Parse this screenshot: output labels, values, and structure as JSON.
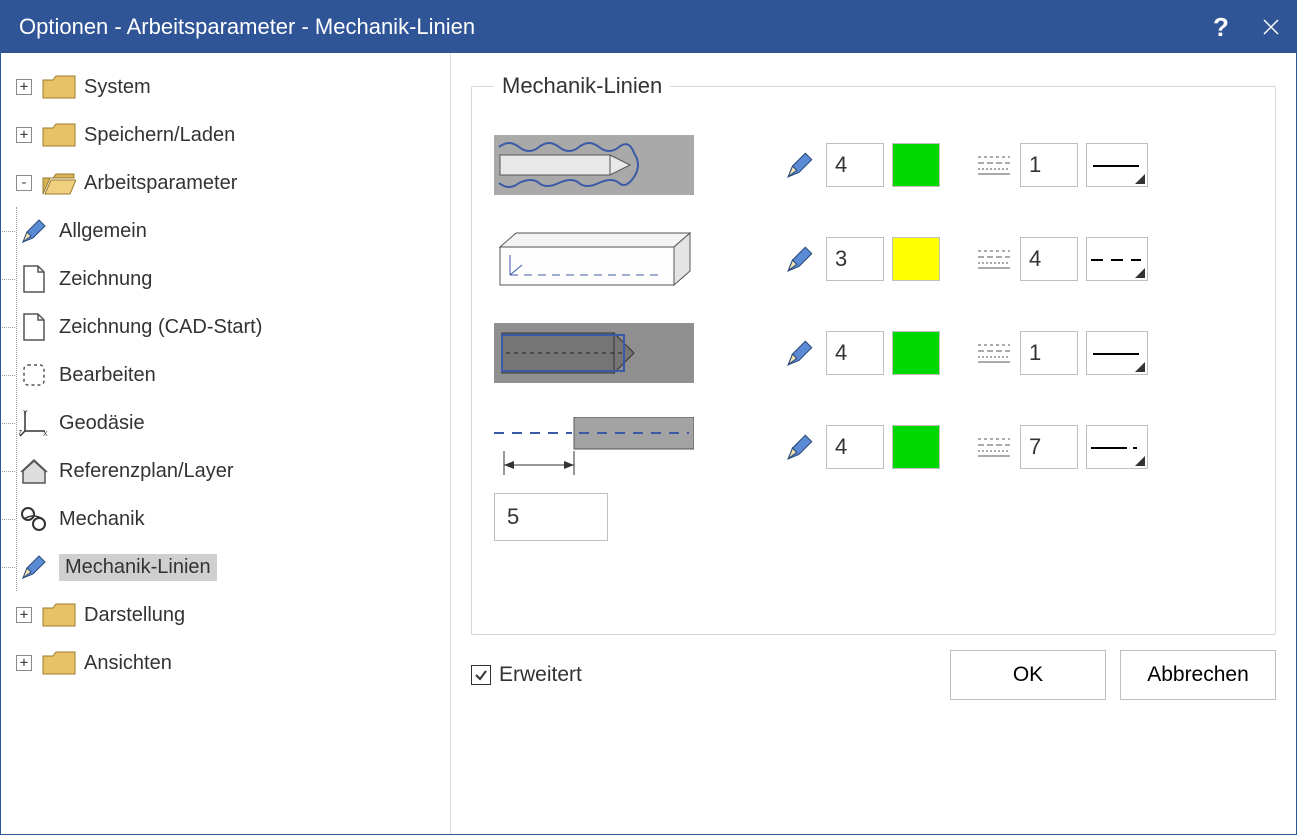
{
  "title": "Optionen - Arbeitsparameter - Mechanik-Linien",
  "tree": {
    "system": "System",
    "save": "Speichern/Laden",
    "work": "Arbeitsparameter",
    "allg": "Allgemein",
    "zeich": "Zeichnung",
    "zeich_cad": "Zeichnung (CAD-Start)",
    "bearb": "Bearbeiten",
    "geod": "Geodäsie",
    "refplan": "Referenzplan/Layer",
    "mech": "Mechanik",
    "mechlin": "Mechanik-Linien",
    "darst": "Darstellung",
    "ansicht": "Ansichten"
  },
  "group_title": "Mechanik-Linien",
  "rows": [
    {
      "pen": "4",
      "color": "#00d900",
      "pat": "1",
      "line": "solid"
    },
    {
      "pen": "3",
      "color": "#ffff00",
      "pat": "4",
      "line": "dash"
    },
    {
      "pen": "4",
      "color": "#00d900",
      "pat": "1",
      "line": "solid"
    },
    {
      "pen": "4",
      "color": "#00d900",
      "pat": "7",
      "line": "dashdot"
    }
  ],
  "extra_value": "5",
  "checkbox_label": "Erweitert",
  "ok": "OK",
  "cancel": "Abbrechen"
}
